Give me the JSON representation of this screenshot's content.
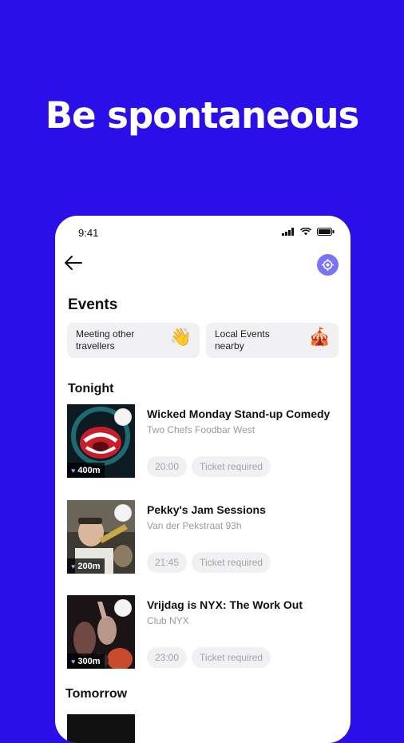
{
  "headline": "Be spontaneous",
  "status_bar": {
    "time": "9:41"
  },
  "page": {
    "title": "Events"
  },
  "chips": [
    {
      "label": "Meeting other travellers",
      "line1": "Meeting other",
      "line2": "travellers",
      "emoji": "👋"
    },
    {
      "label": "Local Events nearby",
      "line1": "Local Events",
      "line2": "nearby",
      "emoji": "🎪"
    }
  ],
  "sections": {
    "tonight": "Tonight",
    "tomorrow": "Tomorrow"
  },
  "events": [
    {
      "title": "Wicked Monday Stand-up Comedy",
      "venue": "Two Chefs Foodbar West",
      "distance": "400m",
      "time": "20:00",
      "ticket": "Ticket required"
    },
    {
      "title": "Pekky's Jam Sessions",
      "venue": "Van der Pekstraat 93h",
      "distance": "200m",
      "time": "21:45",
      "ticket": "Ticket required"
    },
    {
      "title": "Vrijdag is NYX: The Work Out",
      "venue": "Club NYX",
      "distance": "300m",
      "time": "23:00",
      "ticket": "Ticket required"
    }
  ],
  "colors": {
    "background": "#2a0fe8",
    "accent": "#7a73f5"
  }
}
